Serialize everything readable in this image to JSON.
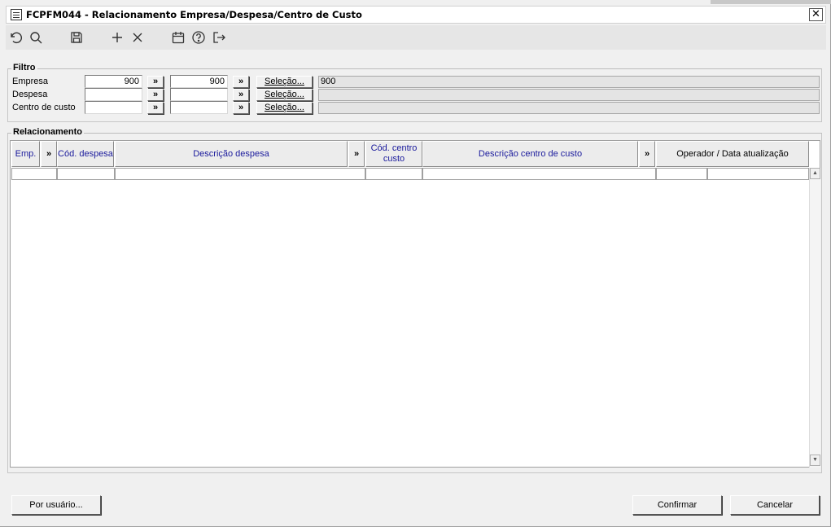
{
  "window": {
    "title": "FCPFM044 - Relacionamento Empresa/Despesa/Centro de Custo",
    "close_label": "✕"
  },
  "toolbar": {
    "icons": [
      "undo-icon",
      "search-icon",
      "save-icon",
      "add-icon",
      "delete-icon",
      "calendar-icon",
      "help-icon",
      "exit-icon"
    ]
  },
  "filtro": {
    "legend": "Filtro",
    "rows": [
      {
        "label": "Empresa",
        "from": "900",
        "to": "900",
        "arrow": "»",
        "selecao": "Seleção...",
        "desc": "900"
      },
      {
        "label": "Despesa",
        "from": "",
        "to": "",
        "arrow": "»",
        "selecao": "Seleção...",
        "desc": ""
      },
      {
        "label": "Centro de custo",
        "from": "",
        "to": "",
        "arrow": "»",
        "selecao": "Seleção...",
        "desc": ""
      }
    ]
  },
  "relacionamento": {
    "legend": "Relacionamento",
    "headers": {
      "emp": "Emp.",
      "arrow1": "»",
      "cod_despesa": "Cód. despesa",
      "desc_despesa": "Descrição despesa",
      "arrow2": "»",
      "cod_centro": "Cód. centro custo",
      "desc_centro": "Descrição centro de custo",
      "arrow3": "»",
      "operador": "Operador / Data atualização"
    }
  },
  "buttons": {
    "por_usuario": "Por usuário...",
    "confirmar": "Confirmar",
    "cancelar": "Cancelar"
  },
  "colors": {
    "header_text": "#1a1a9c",
    "background": "#f0f0f0"
  }
}
